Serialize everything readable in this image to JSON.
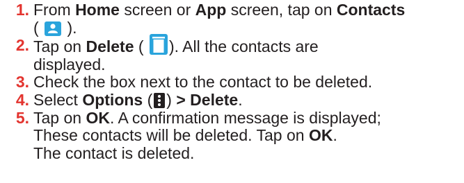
{
  "accent_color": "#e3342f",
  "steps": [
    {
      "number": "1.",
      "text_1": "From ",
      "bold_1": "Home",
      "text_2": " screen or ",
      "bold_2": "App",
      "text_3": " screen, tap on ",
      "bold_3": "Contacts",
      "text_4": "(",
      "icon": "contacts-app-icon",
      "text_5": ")."
    },
    {
      "number": "2.",
      "text_1": "Tap on ",
      "bold_1": "Delete",
      "text_2": " (",
      "icon": "delete-trash-icon",
      "text_3": "). All the contacts are",
      "text_4": "displayed."
    },
    {
      "number": "3.",
      "text_1": "Check the box next to the contact to be deleted."
    },
    {
      "number": "4.",
      "text_1": "Select ",
      "bold_1": "Options",
      "text_2": " (",
      "icon": "options-menu-icon",
      "text_3": ") ",
      "bold_2": "> Delete",
      "text_4": "."
    },
    {
      "number": "5.",
      "text_1": "Tap on ",
      "bold_1": "OK",
      "text_2": ". A confirmation message is displayed;",
      "text_3": "These contacts will be deleted. Tap on ",
      "bold_2": "OK",
      "text_4": ".",
      "text_5": "The contact is deleted."
    }
  ]
}
